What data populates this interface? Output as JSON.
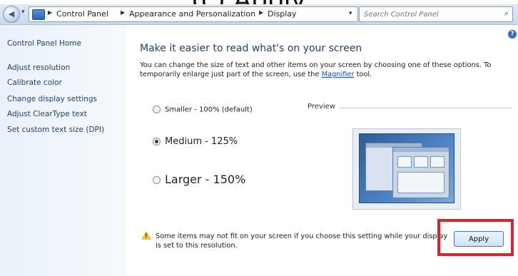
{
  "caption": "(c) Apply",
  "addressbar": {
    "breadcrumbs": [
      "Control Panel",
      "Appearance and Personalization",
      "Display"
    ],
    "search_placeholder": "Search Control Panel"
  },
  "sidebar": {
    "items": [
      {
        "label": "Control Panel Home"
      },
      {
        "label": "Adjust resolution"
      },
      {
        "label": "Calibrate color"
      },
      {
        "label": "Change display settings"
      },
      {
        "label": "Adjust ClearType text"
      },
      {
        "label": "Set custom text size (DPI)"
      }
    ]
  },
  "main": {
    "title": "Make it easier to read what's on your screen",
    "description_pre": "You can change the size of text and other items on your screen by choosing one of these options. To temporarily enlarge just part of the screen, use the ",
    "magnifier_link": "Magnifier",
    "description_post": " tool.",
    "options": [
      {
        "label": "Smaller - 100% (default)",
        "checked": false
      },
      {
        "label": "Medium - 125%",
        "checked": true
      },
      {
        "label": "Larger - 150%",
        "checked": false
      }
    ],
    "preview_label": "Preview",
    "warning_text": "Some items may not fit on your screen if you choose this setting while your display is set to this resolution.",
    "apply_label": "Apply"
  },
  "colors": {
    "highlight": "#d22630",
    "title": "#1d3f75",
    "sidebar_link": "#1e3f6e"
  },
  "icons": [
    "back-arrow-icon",
    "control-panel-icon",
    "refresh-icon",
    "search-icon",
    "help-icon",
    "warning-icon"
  ]
}
